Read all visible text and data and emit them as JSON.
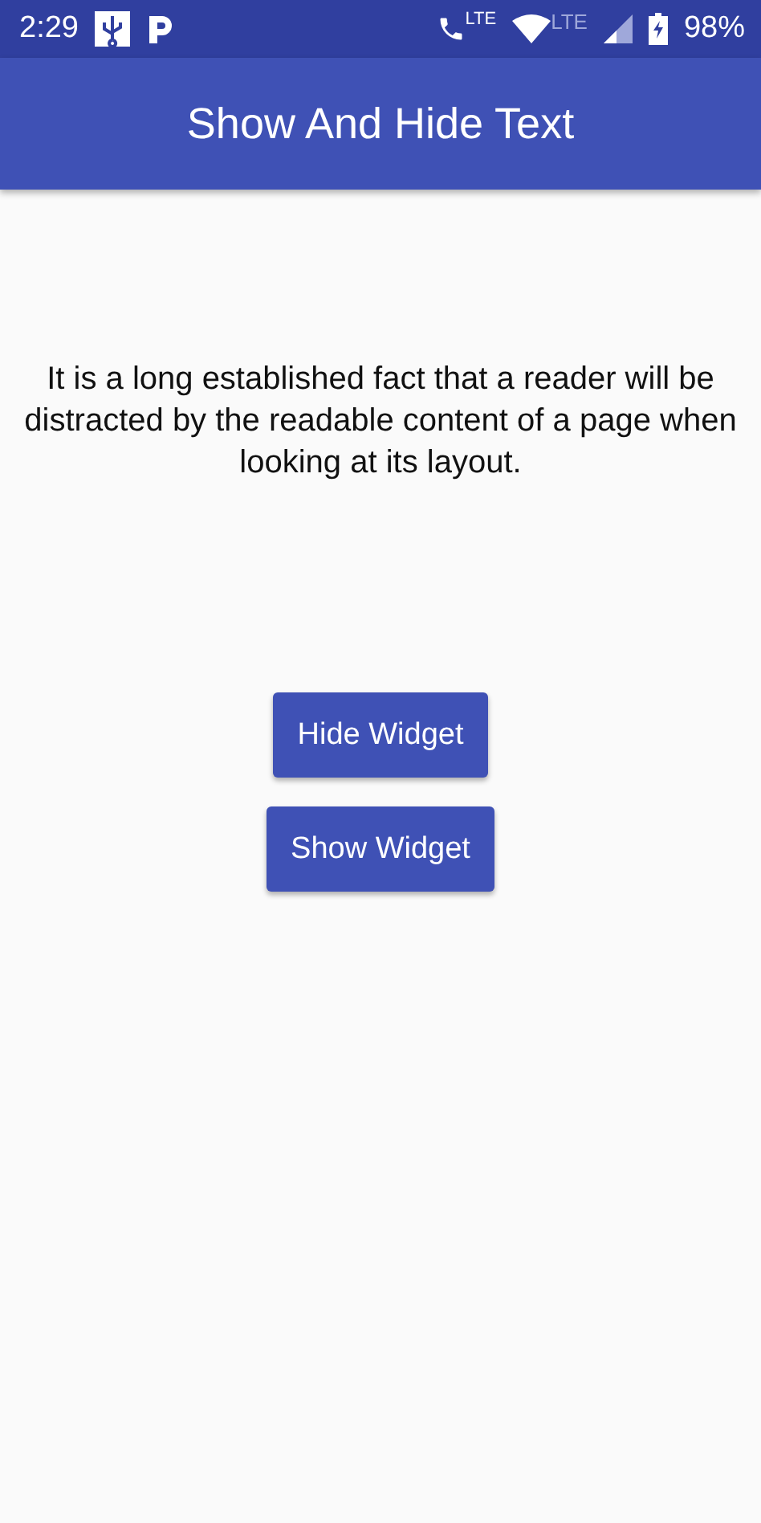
{
  "status_bar": {
    "time": "2:29",
    "call_badge": "LTE",
    "cell_badge": "LTE",
    "battery": "98%"
  },
  "app_bar": {
    "title": "Show And Hide Text"
  },
  "body": {
    "text": "It is a long established fact that a reader will be distracted by the readable content of a page when looking at its layout."
  },
  "buttons": [
    {
      "label": "Hide Widget"
    },
    {
      "label": "Show Widget"
    }
  ]
}
